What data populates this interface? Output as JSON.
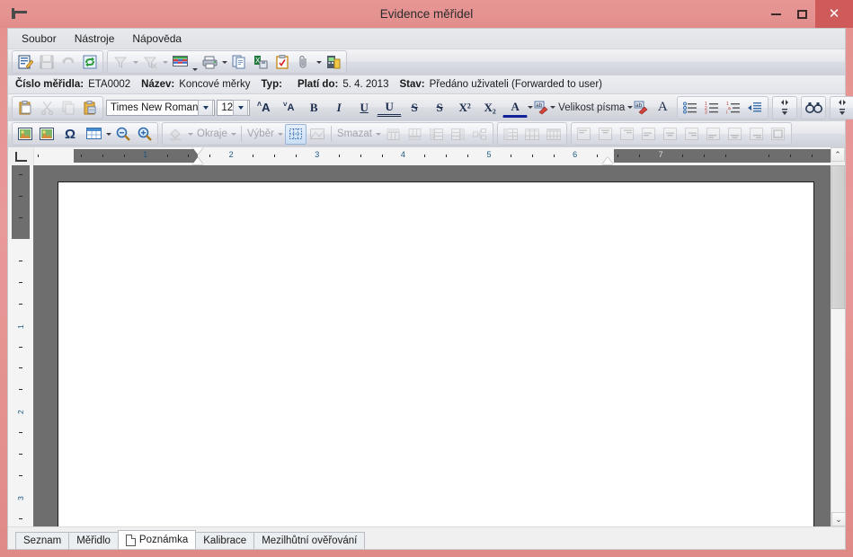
{
  "window": {
    "title": "Evidence měřidel",
    "icon": "caliper-icon",
    "minimize_label": "–",
    "maximize_label": "□",
    "close_label": "✕",
    "accent_color": "#e0908e",
    "close_color": "#cf5a5a"
  },
  "menubar": {
    "items": [
      {
        "label": "Soubor"
      },
      {
        "label": "Nástroje"
      },
      {
        "label": "Nápověda"
      }
    ]
  },
  "main_toolbar": {
    "groups": [
      {
        "buttons": [
          {
            "name": "edit-record-icon",
            "enabled": true
          },
          {
            "name": "save-icon",
            "enabled": false
          },
          {
            "name": "undo-icon",
            "enabled": false
          },
          {
            "name": "refresh-icon",
            "enabled": true
          }
        ]
      },
      {
        "buttons": [
          {
            "name": "filter-icon",
            "enabled": false,
            "dropdown": true
          },
          {
            "name": "filter-remove-icon",
            "enabled": false,
            "dropdown": true
          },
          {
            "name": "table-grid-icon",
            "enabled": true,
            "dropdown": true
          },
          {
            "name": "print-icon",
            "enabled": true,
            "dropdown": true
          },
          {
            "name": "copy-document-icon",
            "enabled": true
          },
          {
            "name": "export-excel-icon",
            "enabled": true
          },
          {
            "name": "clipboard-check-icon",
            "enabled": true
          },
          {
            "name": "attachment-icon",
            "enabled": true,
            "dropdown": true
          },
          {
            "name": "application-icon",
            "enabled": true
          }
        ]
      }
    ]
  },
  "info_bar": {
    "fields": [
      {
        "label": "Číslo měřidla:",
        "value": "ETA0002"
      },
      {
        "label": "Název:",
        "value": "Koncové měrky"
      },
      {
        "label": "Typ:",
        "value": ""
      },
      {
        "label": "Platí do:",
        "value": "5. 4. 2013"
      },
      {
        "label": "Stav:",
        "value": "Předáno uživateli (Forwarded to user)"
      }
    ]
  },
  "format_toolbar": {
    "clipboard": [
      {
        "name": "paste-icon",
        "enabled": true
      },
      {
        "name": "cut-icon",
        "enabled": false
      },
      {
        "name": "copy-icon",
        "enabled": false
      },
      {
        "name": "paste-special-icon",
        "enabled": true
      }
    ],
    "font_name": {
      "value": "Times New Roman"
    },
    "font_size": {
      "value": "12"
    },
    "buttons": [
      {
        "name": "grow-font-button",
        "label": "A",
        "style": "grow"
      },
      {
        "name": "shrink-font-button",
        "label": "A",
        "style": "shrink"
      },
      {
        "name": "bold-button",
        "label": "B",
        "style": "bold"
      },
      {
        "name": "italic-button",
        "label": "I",
        "style": "italic"
      },
      {
        "name": "underline-button",
        "label": "U",
        "style": "underline"
      },
      {
        "name": "double-underline-button",
        "label": "U",
        "style": "double-underline"
      },
      {
        "name": "strikethrough-button",
        "label": "S",
        "style": "strike"
      },
      {
        "name": "double-strikethrough-button",
        "label": "S",
        "style": "double-strike"
      },
      {
        "name": "superscript-button",
        "label": "X²",
        "style": "sup"
      },
      {
        "name": "subscript-button",
        "label": "X₂",
        "style": "sub"
      }
    ],
    "font_color": {
      "name": "font-color-button",
      "label": "A",
      "color": "#10219a"
    },
    "highlight": {
      "name": "text-highlight-button",
      "label": "ab"
    },
    "font_size_menu": {
      "label": "Velikost písma"
    },
    "clear_format": {
      "name": "clear-formatting-button",
      "label": "ab"
    },
    "font_dialog": {
      "name": "font-dialog-button",
      "label": "A"
    },
    "lists": [
      {
        "name": "bullet-list-button"
      },
      {
        "name": "numbered-list-button"
      },
      {
        "name": "multilevel-list-button"
      },
      {
        "name": "indent-button"
      }
    ],
    "right_tools": [
      {
        "name": "spinner-up-down-left"
      },
      {
        "name": "find-binoculars-icon"
      },
      {
        "name": "spinner-up-down-right"
      }
    ]
  },
  "insert_toolbar": {
    "items": [
      {
        "name": "insert-image-icon",
        "kind": "icon",
        "enabled": true
      },
      {
        "name": "insert-picture-icon",
        "kind": "icon",
        "enabled": true
      },
      {
        "name": "insert-symbol-icon",
        "kind": "text",
        "label": "Ω",
        "enabled": true
      },
      {
        "name": "insert-table-icon",
        "kind": "icon",
        "enabled": true,
        "dropdown": true
      },
      {
        "name": "zoom-out-icon",
        "kind": "icon",
        "enabled": true
      },
      {
        "name": "zoom-in-icon",
        "kind": "icon",
        "enabled": true
      },
      {
        "name": "fill-color-icon",
        "kind": "icon",
        "enabled": false,
        "dropdown": true
      },
      {
        "name": "borders-menu",
        "kind": "text",
        "label": "Okraje",
        "enabled": false,
        "dropdown": true
      },
      {
        "name": "selection-menu",
        "kind": "text",
        "label": "Výběr",
        "enabled": false,
        "dropdown": true
      },
      {
        "name": "show-gridlines-icon",
        "kind": "icon",
        "enabled": true,
        "selected": true
      },
      {
        "name": "table-properties-icon",
        "kind": "icon",
        "enabled": false
      },
      {
        "name": "delete-menu",
        "kind": "text",
        "label": "Smazat",
        "enabled": false,
        "dropdown": true
      },
      {
        "name": "insert-row-above-icon",
        "kind": "icon",
        "enabled": false
      },
      {
        "name": "insert-row-below-icon",
        "kind": "icon",
        "enabled": false
      },
      {
        "name": "insert-column-left-icon",
        "kind": "icon",
        "enabled": false
      },
      {
        "name": "insert-column-right-icon",
        "kind": "icon",
        "enabled": false
      },
      {
        "name": "split-cells-icon",
        "kind": "icon",
        "enabled": false
      },
      {
        "name": "merge-cells-icon",
        "kind": "icon",
        "enabled": false
      },
      {
        "name": "table-style-1-icon",
        "kind": "icon",
        "enabled": false
      },
      {
        "name": "table-style-2-icon",
        "kind": "icon",
        "enabled": false
      },
      {
        "name": "align-top-left-icon",
        "kind": "icon",
        "enabled": false
      },
      {
        "name": "align-top-center-icon",
        "kind": "icon",
        "enabled": false
      },
      {
        "name": "align-top-right-icon",
        "kind": "icon",
        "enabled": false
      },
      {
        "name": "align-middle-left-icon",
        "kind": "icon",
        "enabled": false
      },
      {
        "name": "align-middle-center-icon",
        "kind": "icon",
        "enabled": false
      },
      {
        "name": "align-middle-right-icon",
        "kind": "icon",
        "enabled": false
      },
      {
        "name": "align-bottom-left-icon",
        "kind": "icon",
        "enabled": false
      },
      {
        "name": "align-bottom-center-icon",
        "kind": "icon",
        "enabled": false
      },
      {
        "name": "align-bottom-right-icon",
        "kind": "icon",
        "enabled": false
      },
      {
        "name": "cell-margins-icon",
        "kind": "icon",
        "enabled": false
      }
    ]
  },
  "ruler": {
    "horizontal": {
      "numbers": [
        "1",
        "1",
        "2",
        "3",
        "4",
        "5",
        "6",
        "7"
      ],
      "unit": "cm",
      "left_indent_position": "1.6",
      "right_indent_position": "16.4"
    },
    "vertical": {
      "numbers": [
        "1",
        "2",
        "3"
      ]
    }
  },
  "document": {
    "content": "",
    "scrollbar": {
      "up_arrow": "⌃",
      "down_arrow": "⌄"
    }
  },
  "tabs": {
    "items": [
      {
        "label": "Seznam",
        "active": false,
        "icon": null
      },
      {
        "label": "Měřidlo",
        "active": false,
        "icon": null
      },
      {
        "label": "Poznámka",
        "active": true,
        "icon": "page-icon"
      },
      {
        "label": "Kalibrace",
        "active": false,
        "icon": null
      },
      {
        "label": "Mezilhůtní ověřování",
        "active": false,
        "icon": null
      }
    ]
  }
}
